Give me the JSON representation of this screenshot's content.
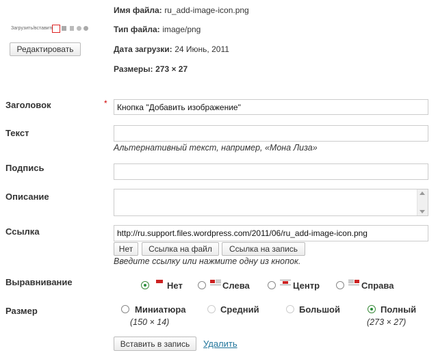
{
  "thumbnail": {
    "text": "Загрузить/вставить"
  },
  "edit_button": "Редактировать",
  "meta": {
    "filename_label": "Имя файла:",
    "filename_value": "ru_add-image-icon.png",
    "type_label": "Тип файла:",
    "type_value": "image/png",
    "date_label": "Дата загрузки:",
    "date_value": "24 Июнь, 2011",
    "size_label": "Размеры:",
    "size_value": "273 × 27"
  },
  "fields": {
    "title_label": "Заголовок",
    "required_mark": "*",
    "title_value": "Кнопка \"Добавить изображение\"",
    "alt_label": "Текст",
    "alt_value": "",
    "alt_hint": "Альтернативный текст, например, «Мона Лиза»",
    "caption_label": "Подпись",
    "caption_value": "",
    "description_label": "Описание",
    "description_value": "",
    "link_label": "Ссылка",
    "link_value": "http://ru.support.files.wordpress.com/2011/06/ru_add-image-icon.png",
    "link_hint": "Введите ссылку или нажмите одну из кнопок."
  },
  "link_buttons": {
    "none": "Нет",
    "file": "Ссылка на файл",
    "post": "Ссылка на запись"
  },
  "alignment": {
    "label": "Выравнивание",
    "options": [
      {
        "label": "Нет",
        "selected": true
      },
      {
        "label": "Слева",
        "selected": false
      },
      {
        "label": "Центр",
        "selected": false
      },
      {
        "label": "Справа",
        "selected": false
      }
    ]
  },
  "size": {
    "label": "Размер",
    "options": [
      {
        "label": "Миниатюра",
        "dims": "(150 × 14)",
        "selected": false,
        "enabled": true
      },
      {
        "label": "Средний",
        "dims": "",
        "selected": false,
        "enabled": false
      },
      {
        "label": "Большой",
        "dims": "",
        "selected": false,
        "enabled": false
      },
      {
        "label": "Полный",
        "dims": "(273 × 27)",
        "selected": true,
        "enabled": true
      }
    ]
  },
  "actions": {
    "insert": "Вставить в запись",
    "delete": "Удалить"
  },
  "colors": {
    "accent_link": "#21759b",
    "required": "#d00000",
    "radio_selected": "#2a8f3a",
    "align_icon_red": "#cc2222"
  }
}
